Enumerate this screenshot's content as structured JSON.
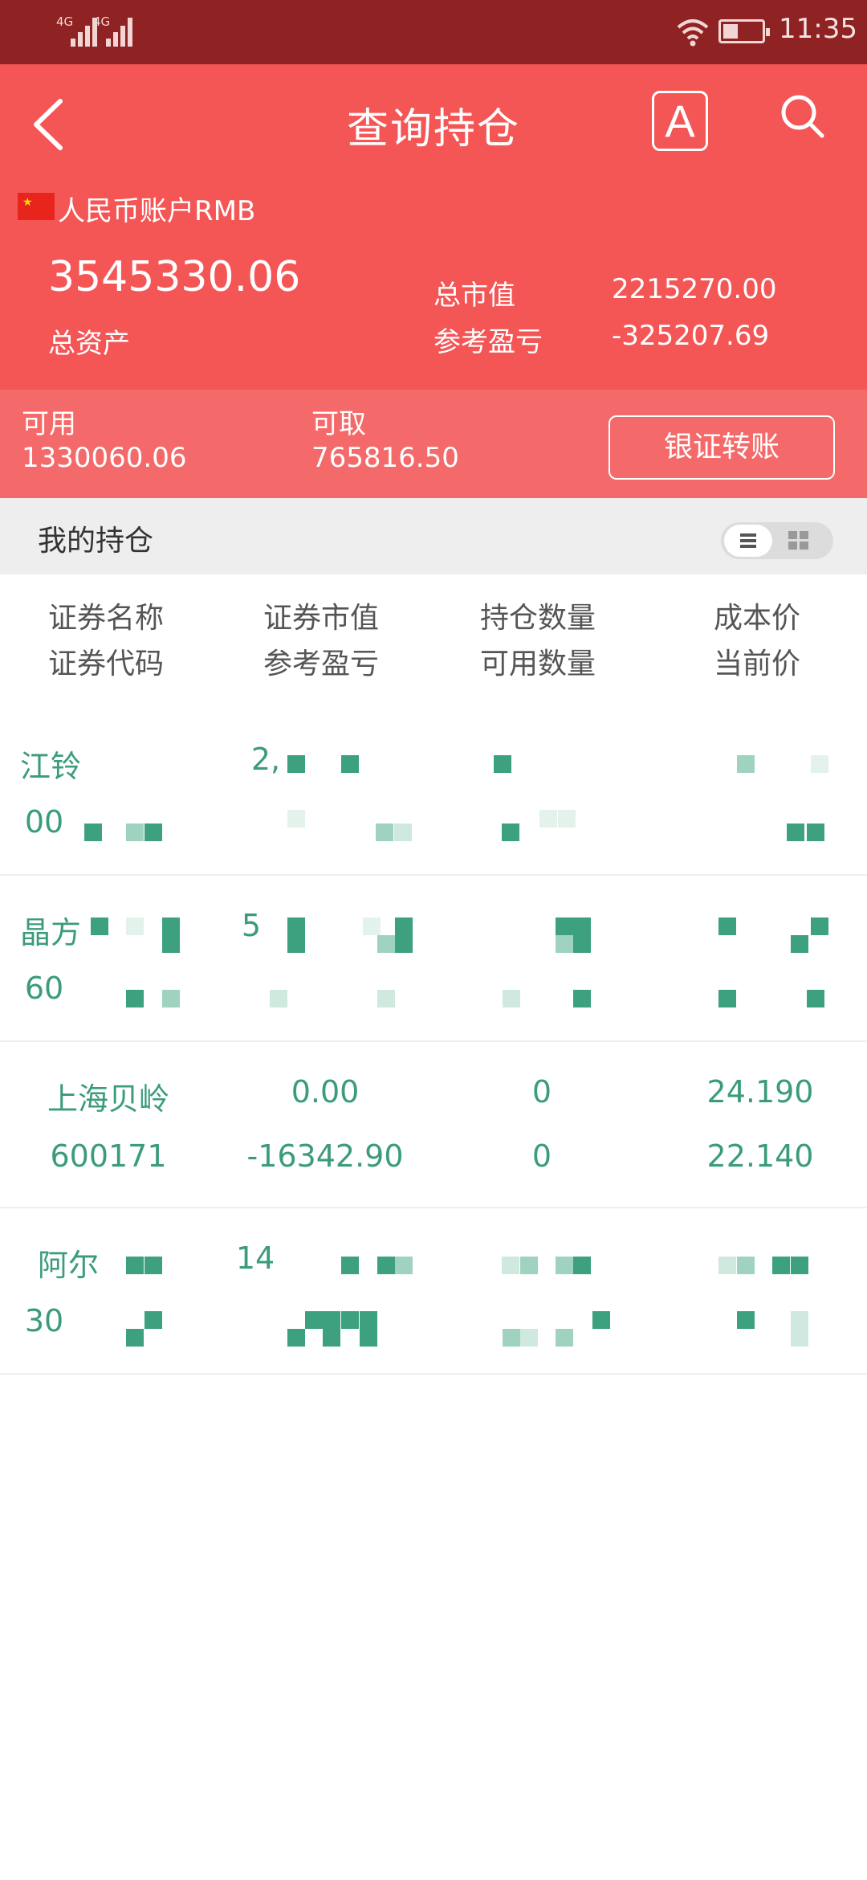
{
  "status_bar": {
    "signal_1": "4G",
    "signal_2": "4G",
    "time": "11:35"
  },
  "header": {
    "title": "查询持仓",
    "font_button": "A",
    "account": "人民币账户RMB",
    "total_assets_value": "3545330.06",
    "total_assets_label": "总资产",
    "market_value_label": "总市值",
    "market_value": "2215270.00",
    "pnl_label": "参考盈亏",
    "pnl_value": "-325207.69"
  },
  "funds": {
    "available_label": "可用",
    "available_value": "1330060.06",
    "withdrawable_label": "可取",
    "withdrawable_value": "765816.50",
    "transfer_button": "银证转账"
  },
  "section": {
    "title": "我的持仓"
  },
  "table": {
    "columns": [
      {
        "line1": "证券名称",
        "line2": "证券代码"
      },
      {
        "line1": "证券市值",
        "line2": "参考盈亏"
      },
      {
        "line1": "持仓数量",
        "line2": "可用数量"
      },
      {
        "line1": "成本价",
        "line2": "当前价"
      }
    ],
    "rows": [
      {
        "name": "江铃",
        "code": "00",
        "market_value": "2,",
        "pnl": "",
        "qty": "",
        "avail": "",
        "cost": "",
        "price": ""
      },
      {
        "name": "晶方",
        "code": "60",
        "market_value": "5",
        "pnl": "",
        "qty": "",
        "avail": "",
        "cost": "",
        "price": ""
      },
      {
        "name": "上海贝岭",
        "code": "600171",
        "market_value": "0.00",
        "pnl": "-16342.90",
        "qty": "0",
        "avail": "0",
        "cost": "24.190",
        "price": "22.140"
      },
      {
        "name": "阿尔",
        "code": "30",
        "market_value": "14",
        "pnl": "",
        "qty": "",
        "avail": "",
        "cost": "",
        "price": ""
      }
    ]
  },
  "colors": {
    "status_bar": "#8f2222",
    "header": "#f45656",
    "funds_band": "#f46a6a",
    "positive_text": "#3b9c7a"
  }
}
